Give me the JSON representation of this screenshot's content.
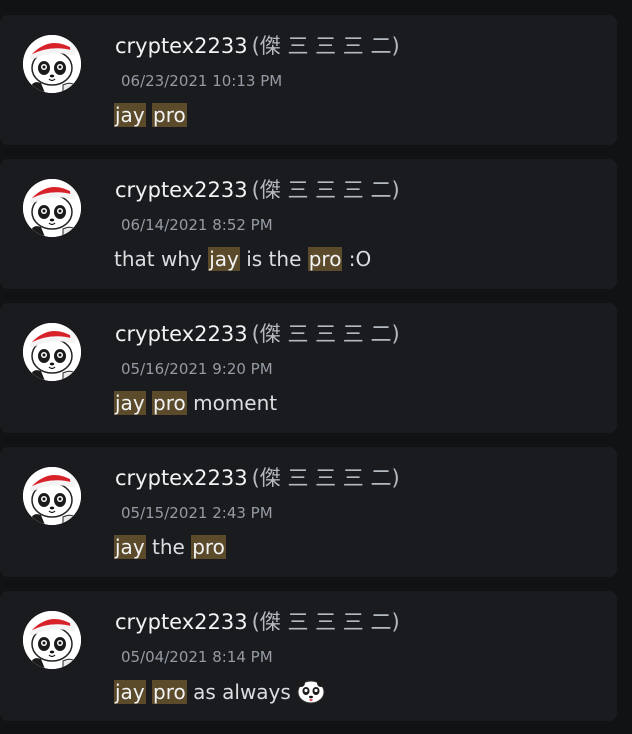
{
  "results": [
    {
      "username": "cryptex2233",
      "nickname": "(傑 三 三 三 二)",
      "timestamp": "06/23/2021 10:13 PM",
      "message": [
        {
          "text": "jay",
          "highlight": true
        },
        {
          "text": " ",
          "highlight": false
        },
        {
          "text": "pro",
          "highlight": true
        }
      ]
    },
    {
      "username": "cryptex2233",
      "nickname": "(傑 三 三 三 二)",
      "timestamp": "06/14/2021 8:52 PM",
      "message": [
        {
          "text": "that why ",
          "highlight": false
        },
        {
          "text": "jay",
          "highlight": true
        },
        {
          "text": " is the ",
          "highlight": false
        },
        {
          "text": "pro",
          "highlight": true
        },
        {
          "text": " :O",
          "highlight": false
        }
      ]
    },
    {
      "username": "cryptex2233",
      "nickname": "(傑 三 三 三 二)",
      "timestamp": "05/16/2021 9:20 PM",
      "message": [
        {
          "text": "jay",
          "highlight": true
        },
        {
          "text": " ",
          "highlight": false
        },
        {
          "text": "pro",
          "highlight": true
        },
        {
          "text": " moment",
          "highlight": false
        }
      ]
    },
    {
      "username": "cryptex2233",
      "nickname": "(傑 三 三 三 二)",
      "timestamp": "05/15/2021 2:43 PM",
      "message": [
        {
          "text": "jay",
          "highlight": true
        },
        {
          "text": " the ",
          "highlight": false
        },
        {
          "text": "pro",
          "highlight": true
        }
      ]
    },
    {
      "username": "cryptex2233",
      "nickname": "(傑 三 三 三 二)",
      "timestamp": "05/04/2021 8:14 PM",
      "message": [
        {
          "text": "jay",
          "highlight": true
        },
        {
          "text": " ",
          "highlight": false
        },
        {
          "text": "pro",
          "highlight": true
        },
        {
          "text": " as always",
          "highlight": false
        }
      ],
      "trailing_emoji": "panda-emoji"
    }
  ],
  "colors": {
    "background": "#111214",
    "card": "#1a1b1e",
    "highlight": "#5c4b2b",
    "username": "#f2f3f5",
    "timestamp": "#949ba4"
  }
}
